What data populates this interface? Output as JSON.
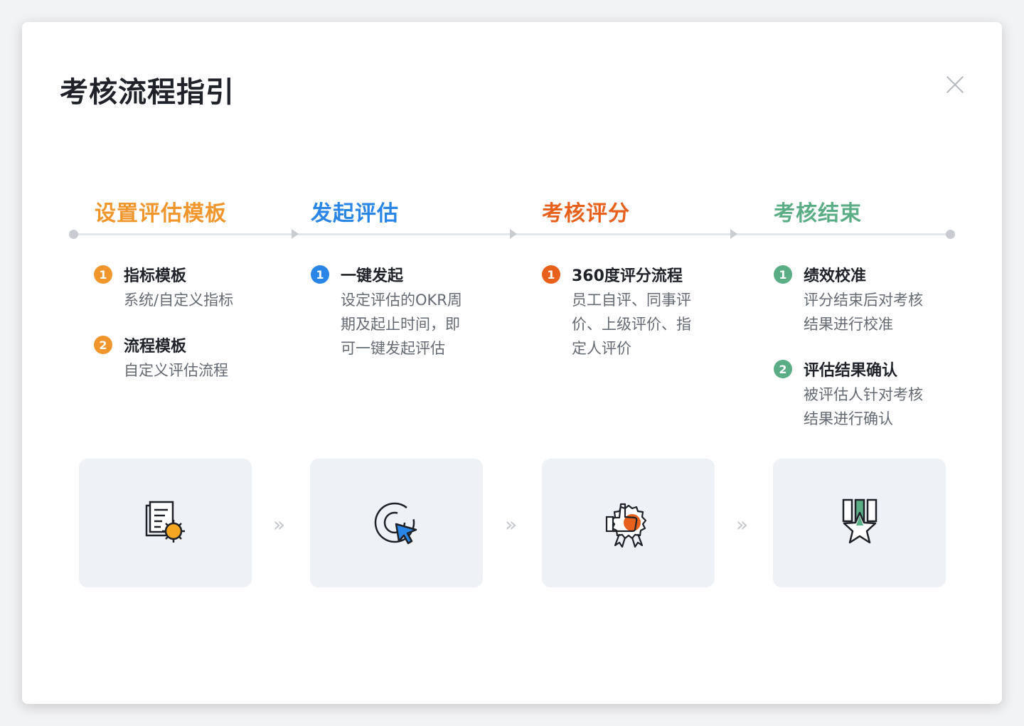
{
  "modal": {
    "title": "考核流程指引"
  },
  "stages": [
    {
      "title": "设置评估模板",
      "color": "#f0962c",
      "icon": "template-settings-icon",
      "items": [
        {
          "num": "1",
          "title": "指标模板",
          "desc": "系统/自定义指标"
        },
        {
          "num": "2",
          "title": "流程模板",
          "desc": "自定义评估流程"
        }
      ]
    },
    {
      "title": "发起评估",
      "color": "#2a86e6",
      "icon": "target-cursor-icon",
      "items": [
        {
          "num": "1",
          "title": "一键发起",
          "desc": "设定评估的OKR周\n期及起止时间，即\n可一键发起评估"
        }
      ]
    },
    {
      "title": "考核评分",
      "color": "#e8611c",
      "icon": "thumbs-up-award-icon",
      "items": [
        {
          "num": "1",
          "title": "360度评分流程",
          "desc": "员工自评、同事评\n价、上级评价、指\n定人评价"
        }
      ]
    },
    {
      "title": "考核结束",
      "color": "#5aad85",
      "icon": "star-medal-icon",
      "items": [
        {
          "num": "1",
          "title": "绩效校准",
          "desc": "评分结束后对考核\n结果进行校准"
        },
        {
          "num": "2",
          "title": "评估结果确认",
          "desc": "被评估人针对考核\n结果进行确认"
        }
      ]
    }
  ]
}
